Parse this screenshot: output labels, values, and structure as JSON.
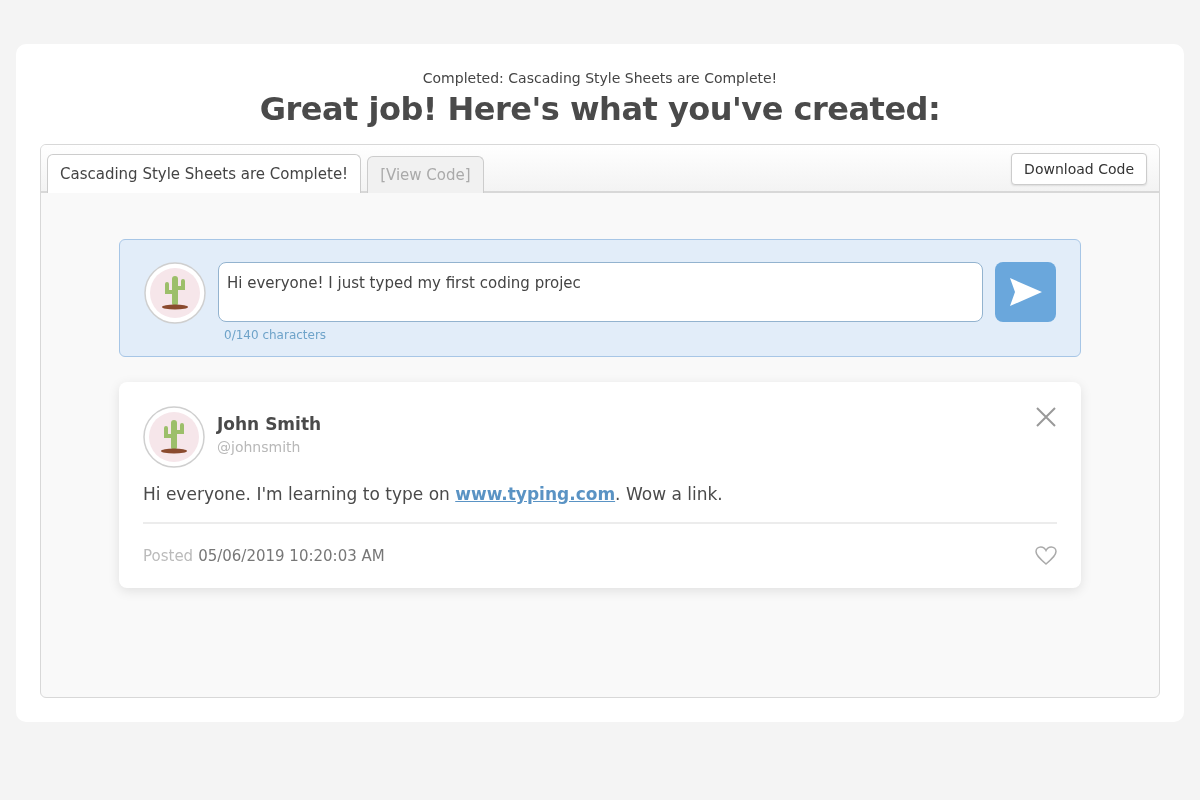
{
  "header": {
    "subtitle": "Completed: Cascading Style Sheets are Complete!",
    "title": "Great job! Here's what you've created:"
  },
  "tabs": [
    {
      "label": "Cascading Style Sheets are Complete!",
      "selected": true
    },
    {
      "label": "[View Code]",
      "selected": false
    }
  ],
  "download_button": "Download Code",
  "compose": {
    "value": "Hi everyone! I just typed my first coding projec",
    "counter": "0/140 characters"
  },
  "post": {
    "name": "John Smith",
    "handle": "@johnsmith",
    "message": [
      {
        "kind": "text",
        "text": "Hi everyone. I'm learning to type on "
      },
      {
        "kind": "link",
        "text": "www.typing.com"
      },
      {
        "kind": "text",
        "text": ". Wow a link."
      }
    ],
    "posted_label": "Posted",
    "date": "05/06/2019 10:20:03 AM"
  }
}
